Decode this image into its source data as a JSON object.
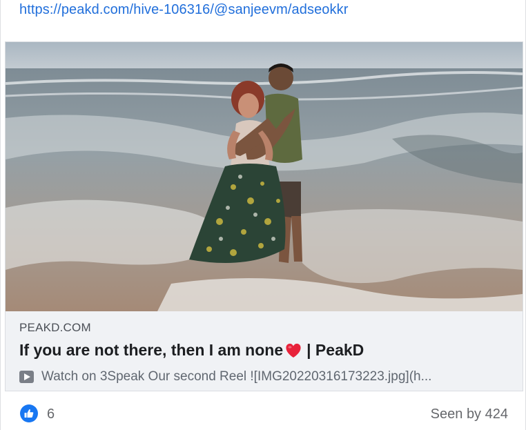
{
  "post": {
    "link": "https://peakd.com/hive-106316/@sanjeevm/adseokkr"
  },
  "preview": {
    "image_alt": "Couple embracing in the sea waves on a beach",
    "domain": "PEAKD.COM",
    "title_before_heart": "If you are not there, then I am none",
    "title_after_heart": " | PeakD",
    "heart_icon": "red-heart-emoji",
    "play_icon": "play-button-emoji",
    "description": "Watch on 3Speak Our second Reel ![IMG20220316173223.jpg](h..."
  },
  "reactions": {
    "like_icon": "thumbs-up-icon",
    "like_count": "6",
    "seen_by": "Seen by 424"
  },
  "colors": {
    "link": "#216fdb",
    "like_blue": "#1877f2",
    "heart_red": "#e8223a",
    "preview_bg": "#f0f2f5"
  }
}
